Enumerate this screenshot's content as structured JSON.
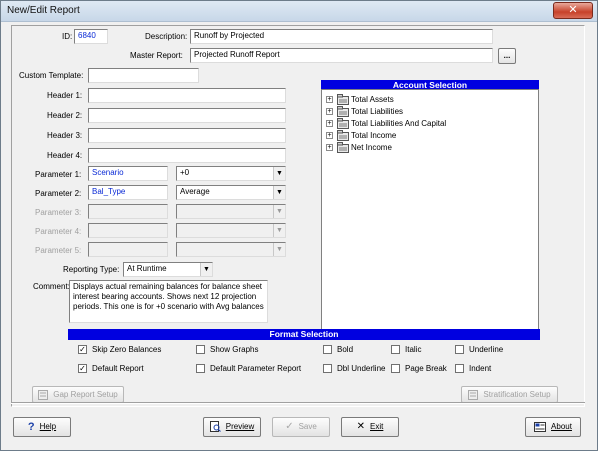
{
  "window": {
    "title": "New/Edit Report",
    "close_glyph": "✕"
  },
  "form": {
    "id_label": "ID:",
    "id_value": "6840",
    "description_label": "Description:",
    "description_value": "Runoff by Projected",
    "master_report_label": "Master Report:",
    "master_report_value": "Projected Runoff Report",
    "browse_label": "...",
    "custom_template_label": "Custom Template:",
    "custom_template_value": "",
    "headers": [
      {
        "label": "Header 1:",
        "value": ""
      },
      {
        "label": "Header 2:",
        "value": ""
      },
      {
        "label": "Header 3:",
        "value": ""
      },
      {
        "label": "Header 4:",
        "value": ""
      }
    ],
    "parameters": [
      {
        "label": "Parameter 1:",
        "value": "Scenario",
        "option": "+0",
        "enabled": true
      },
      {
        "label": "Parameter 2:",
        "value": "Bal_Type",
        "option": "Average",
        "enabled": true
      },
      {
        "label": "Parameter 3:",
        "value": "",
        "option": "",
        "enabled": false
      },
      {
        "label": "Parameter 4:",
        "value": "",
        "option": "",
        "enabled": false
      },
      {
        "label": "Parameter 5:",
        "value": "",
        "option": "",
        "enabled": false
      }
    ],
    "reporting_type_label": "Reporting Type:",
    "reporting_type_value": "At Runtime",
    "comment_label": "Comment:",
    "comment_value": "Displays actual remaining balances for balance sheet interest bearing accounts.  Shows next 12 projection periods.  This one is for +0 scenario with Avg balances"
  },
  "account_selection": {
    "header": "Account Selection",
    "items": [
      "Total Assets",
      "Total Liabilities",
      "Total Liabilities And Capital",
      "Total Income",
      "Net Income"
    ],
    "expand_glyph": "+"
  },
  "format_selection": {
    "header": "Format Selection",
    "options": [
      {
        "label": "Skip Zero Balances",
        "checked": true
      },
      {
        "label": "Show Graphs",
        "checked": false
      },
      {
        "label": "Bold",
        "checked": false
      },
      {
        "label": "Italic",
        "checked": false
      },
      {
        "label": "Underline",
        "checked": false
      },
      {
        "label": "Default Report",
        "checked": true
      },
      {
        "label": "Default Parameter Report",
        "checked": false
      },
      {
        "label": "Dbl Underline",
        "checked": false
      },
      {
        "label": "Page Break",
        "checked": false
      },
      {
        "label": "Indent",
        "checked": false
      }
    ],
    "check_glyph": "✓"
  },
  "buttons": {
    "gap_report_setup": "Gap Report Setup",
    "stratification_setup": "Stratification Setup",
    "help": "Help",
    "preview": "Preview",
    "save": "Save",
    "exit": "Exit",
    "about": "About"
  },
  "colors": {
    "header_blue": "#0000e0",
    "value_blue": "#0a2ad6"
  },
  "icons": [
    "close-icon",
    "browse-icon",
    "folder-icon",
    "help-icon",
    "preview-icon",
    "save-icon",
    "exit-icon",
    "about-icon",
    "gap-report-icon",
    "stratification-icon"
  ]
}
